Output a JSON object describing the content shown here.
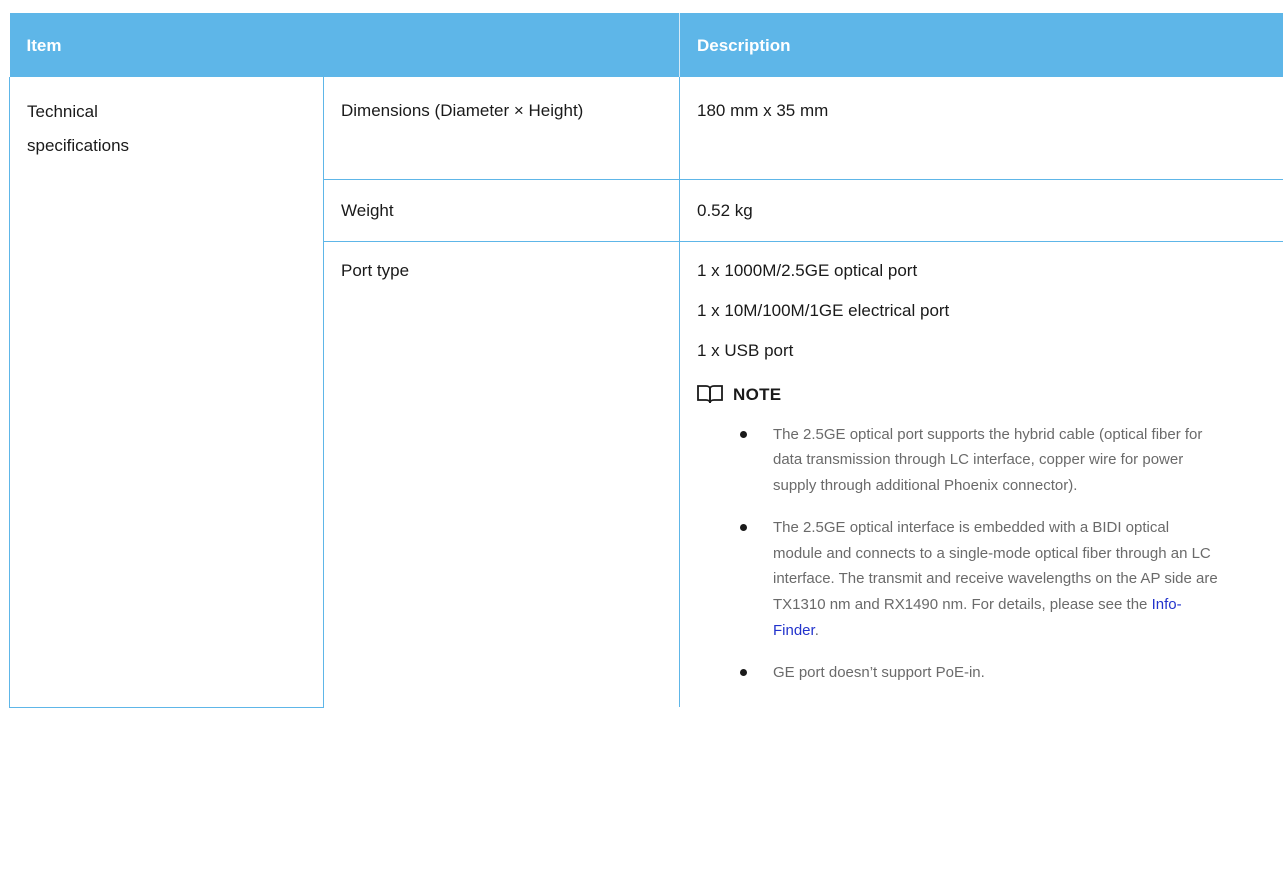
{
  "header": {
    "item": "Item",
    "description": "Description"
  },
  "rows": {
    "category": "Technical specifications",
    "dimensions": {
      "label": "Dimensions (Diameter × Height)",
      "value": "180 mm x 35 mm"
    },
    "weight": {
      "label": "Weight",
      "value": "0.52 kg"
    },
    "port_type": {
      "label": "Port type",
      "values": [
        "1 x 1000M/2.5GE optical port",
        "1 x 10M/100M/1GE electrical port",
        "1 x USB port"
      ],
      "note": {
        "title": "NOTE",
        "items": [
          "The 2.5GE optical port supports the hybrid cable (optical fiber for data transmission through LC interface, copper wire for power supply through additional Phoenix connector).",
          "The 2.5GE optical interface is embedded with a BIDI optical module and connects to a single-mode optical fiber through an LC interface. The transmit and receive wavelengths on the AP side are TX1310 nm and RX1490 nm. For details, please see the",
          "GE port doesn’t support PoE-in."
        ],
        "link_text": "Info-Finder",
        "link_suffix": "."
      }
    }
  },
  "colors": {
    "header_bg": "#5eb6e8",
    "note_text": "#6a6a6a",
    "link": "#2233cc"
  }
}
